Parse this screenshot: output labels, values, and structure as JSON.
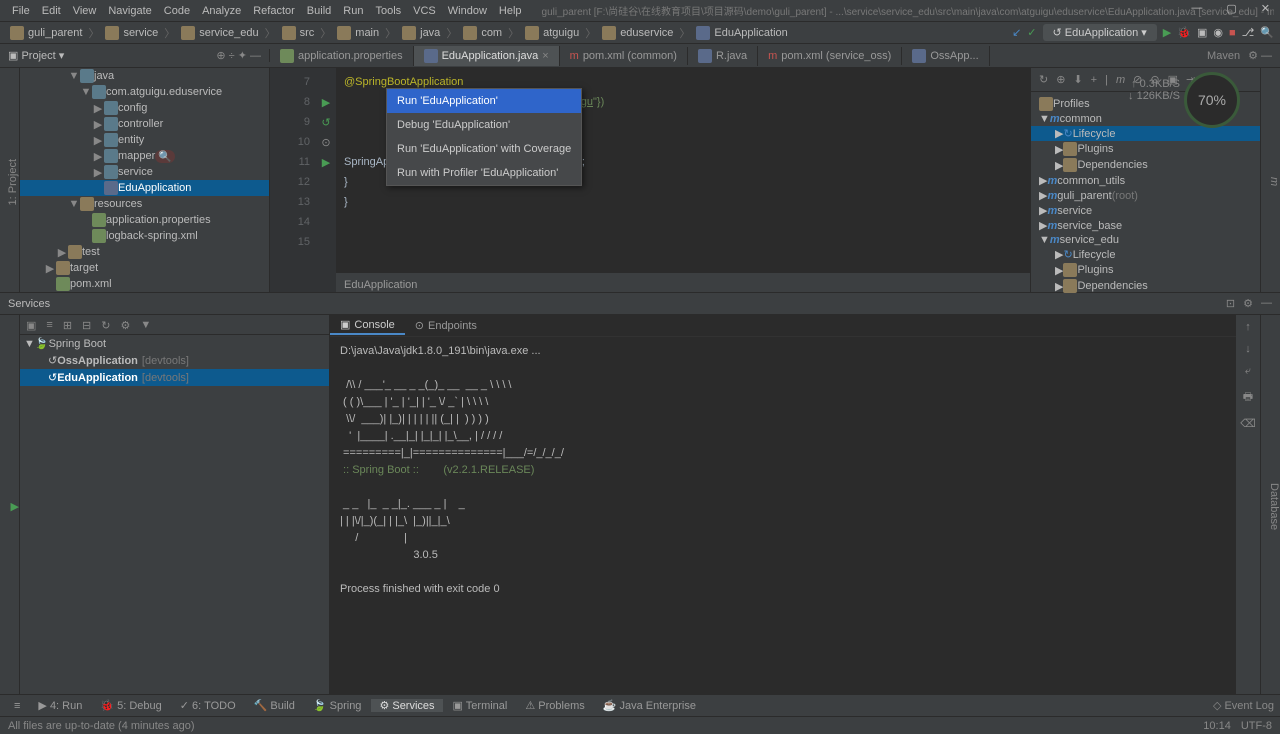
{
  "menu": {
    "items": [
      "File",
      "Edit",
      "View",
      "Navigate",
      "Code",
      "Analyze",
      "Refactor",
      "Build",
      "Run",
      "Tools",
      "VCS",
      "Window",
      "Help"
    ],
    "title": "guli_parent [F:\\尚硅谷\\在线教育项目\\项目源码\\demo\\guli_parent] - ...\\service\\service_edu\\src\\main\\java\\com\\atguigu\\eduservice\\EduApplication.java [service_edu] - IntelliJ IDEA"
  },
  "breadcrumbs": [
    "guli_parent",
    "service",
    "service_edu",
    "src",
    "main",
    "java",
    "com",
    "atguigu",
    "eduservice",
    "EduApplication"
  ],
  "run_config": "EduApplication",
  "project_label": "Project",
  "maven_label": "Maven",
  "tabs": [
    {
      "label": "application.properties"
    },
    {
      "label": "EduApplication.java",
      "active": true
    },
    {
      "label": "pom.xml (common)"
    },
    {
      "label": "R.java"
    },
    {
      "label": "pom.xml (service_oss)"
    },
    {
      "label": "OssApp..."
    }
  ],
  "tree": [
    {
      "d": 4,
      "t": "▼",
      "i": "pkg",
      "l": "java"
    },
    {
      "d": 5,
      "t": "▼",
      "i": "pkg",
      "l": "com.atguigu.eduservice"
    },
    {
      "d": 6,
      "t": "▶",
      "i": "pkg",
      "l": "config"
    },
    {
      "d": 6,
      "t": "▶",
      "i": "pkg",
      "l": "controller"
    },
    {
      "d": 6,
      "t": "▶",
      "i": "pkg",
      "l": "entity"
    },
    {
      "d": 6,
      "t": "▶",
      "i": "pkg",
      "l": "mapper",
      "extra": "search"
    },
    {
      "d": 6,
      "t": "▶",
      "i": "pkg",
      "l": "service"
    },
    {
      "d": 6,
      "t": "",
      "i": "class",
      "l": "EduApplication",
      "sel": true
    },
    {
      "d": 4,
      "t": "▼",
      "i": "folder",
      "l": "resources"
    },
    {
      "d": 5,
      "t": "",
      "i": "file",
      "l": "application.properties"
    },
    {
      "d": 5,
      "t": "",
      "i": "file",
      "l": "logback-spring.xml"
    },
    {
      "d": 3,
      "t": "▶",
      "i": "folder",
      "l": "test"
    },
    {
      "d": 2,
      "t": "▶",
      "i": "folder",
      "l": "target"
    },
    {
      "d": 2,
      "t": "",
      "i": "file",
      "l": "pom.xml"
    }
  ],
  "gutter": [
    "7",
    "8",
    "9",
    "10",
    "11",
    "12",
    "13",
    "14",
    "15"
  ],
  "code": {
    "l1": "@SpringBootApplication",
    "l2a": "Packages = {",
    "l2b": "\"com.",
    "l2c": "atguigu",
    "l2d": "\"})",
    "l3": "lication {",
    "l4a": "oid ",
    "l4b": "main",
    "l4c": "(String[] args) {",
    "l5a": "        SpringApplication.",
    "l5b": "run",
    "l5c": "(",
    "l5d": "EduApplication",
    "l5e": ".",
    "l5f": "class",
    "l5g": ",args);",
    "l6": "    }",
    "l7": "}"
  },
  "ctx": [
    "Run 'EduApplication'",
    "Debug 'EduApplication'",
    "Run 'EduApplication' with Coverage",
    "Run with Profiler 'EduApplication'"
  ],
  "editor_crumb": "EduApplication",
  "maven_tree": [
    {
      "d": 0,
      "t": "",
      "l": "Profiles",
      "i": "folder"
    },
    {
      "d": 0,
      "t": "▼",
      "l": "common",
      "i": "m"
    },
    {
      "d": 1,
      "t": "▶",
      "l": "Lifecycle",
      "i": "cycle",
      "sel": true
    },
    {
      "d": 1,
      "t": "▶",
      "l": "Plugins",
      "i": "folder"
    },
    {
      "d": 1,
      "t": "▶",
      "l": "Dependencies",
      "i": "folder"
    },
    {
      "d": 0,
      "t": "▶",
      "l": "common_utils",
      "i": "m"
    },
    {
      "d": 0,
      "t": "▶",
      "l": "guli_parent",
      "i": "m",
      "suffix": "(root)"
    },
    {
      "d": 0,
      "t": "▶",
      "l": "service",
      "i": "m"
    },
    {
      "d": 0,
      "t": "▶",
      "l": "service_base",
      "i": "m"
    },
    {
      "d": 0,
      "t": "▼",
      "l": "service_edu",
      "i": "m"
    },
    {
      "d": 1,
      "t": "▶",
      "l": "Lifecycle",
      "i": "cycle"
    },
    {
      "d": 1,
      "t": "▶",
      "l": "Plugins",
      "i": "folder"
    },
    {
      "d": 1,
      "t": "▶",
      "l": "Dependencies",
      "i": "folder"
    }
  ],
  "gauge": {
    "pct": "70%",
    "up": "↑ 0.3KB/S",
    "down": "↓ 126KB/S"
  },
  "services": {
    "label": "Services",
    "tree_hdr": [
      "▣",
      "≡",
      "⊞",
      "⊟",
      "↻",
      "⚙",
      "▼"
    ],
    "root": "Spring Boot",
    "items": [
      {
        "l": "OssApplication",
        "tag": "[devtools]"
      },
      {
        "l": "EduApplication",
        "tag": "[devtools]",
        "sel": true
      }
    ]
  },
  "console": {
    "tabs": [
      "Console",
      "Endpoints"
    ],
    "cmd": "D:\\java\\Java\\jdk1.8.0_191\\bin\\java.exe ...",
    "banner": "\n  /\\\\ / ___'_ __ _ _(_)_ __  __ _ \\ \\ \\ \\\n ( ( )\\___ | '_ | '_| | '_ \\/ _` | \\ \\ \\ \\\n  \\\\/  ___)| |_)| | | | | || (_| |  ) ) ) )\n   '  |____| .__|_| |_|_| |_\\__, | / / / /\n =========|_|==============|___/=/_/_/_/",
    "sb": " :: Spring Boot ::        (v2.2.1.RELEASE)",
    "mybatis": "\n _ _   |_  _ _|_. ___ _ |    _\n| | |\\/|_)(_| | |_\\  |_)||_|_\\\n     /               |\n                        3.0.5",
    "exit": "\nProcess finished with exit code 0"
  },
  "bottom": [
    "≡",
    "▶ 4: Run",
    "🐞 5: Debug",
    "✓ 6: TODO",
    "🔨 Build",
    "🍃 Spring",
    "⚙ Services",
    "▣ Terminal",
    "⚠ Problems",
    "☕ Java Enterprise"
  ],
  "status": {
    "msg": "All files are up-to-date (4 minutes ago)",
    "pos": "10:14",
    "enc": "UTF-8"
  }
}
